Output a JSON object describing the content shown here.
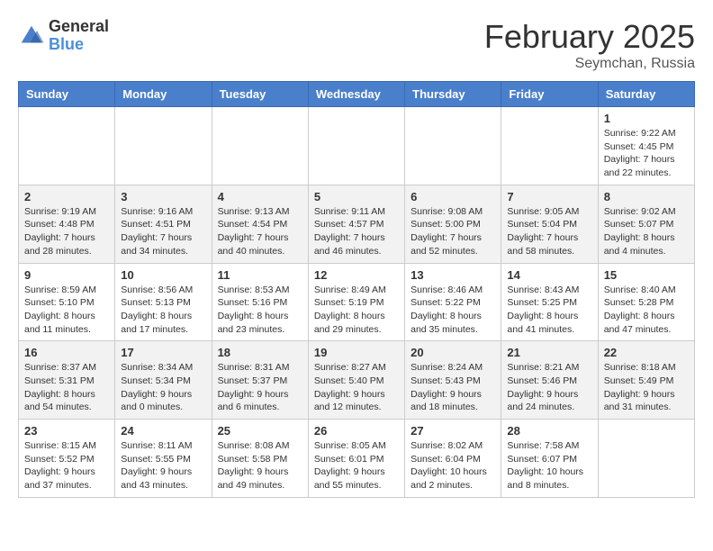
{
  "header": {
    "logo_general": "General",
    "logo_blue": "Blue",
    "month_title": "February 2025",
    "location": "Seymchan, Russia"
  },
  "weekdays": [
    "Sunday",
    "Monday",
    "Tuesday",
    "Wednesday",
    "Thursday",
    "Friday",
    "Saturday"
  ],
  "weeks": [
    [
      {
        "day": "",
        "info": ""
      },
      {
        "day": "",
        "info": ""
      },
      {
        "day": "",
        "info": ""
      },
      {
        "day": "",
        "info": ""
      },
      {
        "day": "",
        "info": ""
      },
      {
        "day": "",
        "info": ""
      },
      {
        "day": "1",
        "info": "Sunrise: 9:22 AM\nSunset: 4:45 PM\nDaylight: 7 hours and 22 minutes."
      }
    ],
    [
      {
        "day": "2",
        "info": "Sunrise: 9:19 AM\nSunset: 4:48 PM\nDaylight: 7 hours and 28 minutes."
      },
      {
        "day": "3",
        "info": "Sunrise: 9:16 AM\nSunset: 4:51 PM\nDaylight: 7 hours and 34 minutes."
      },
      {
        "day": "4",
        "info": "Sunrise: 9:13 AM\nSunset: 4:54 PM\nDaylight: 7 hours and 40 minutes."
      },
      {
        "day": "5",
        "info": "Sunrise: 9:11 AM\nSunset: 4:57 PM\nDaylight: 7 hours and 46 minutes."
      },
      {
        "day": "6",
        "info": "Sunrise: 9:08 AM\nSunset: 5:00 PM\nDaylight: 7 hours and 52 minutes."
      },
      {
        "day": "7",
        "info": "Sunrise: 9:05 AM\nSunset: 5:04 PM\nDaylight: 7 hours and 58 minutes."
      },
      {
        "day": "8",
        "info": "Sunrise: 9:02 AM\nSunset: 5:07 PM\nDaylight: 8 hours and 4 minutes."
      }
    ],
    [
      {
        "day": "9",
        "info": "Sunrise: 8:59 AM\nSunset: 5:10 PM\nDaylight: 8 hours and 11 minutes."
      },
      {
        "day": "10",
        "info": "Sunrise: 8:56 AM\nSunset: 5:13 PM\nDaylight: 8 hours and 17 minutes."
      },
      {
        "day": "11",
        "info": "Sunrise: 8:53 AM\nSunset: 5:16 PM\nDaylight: 8 hours and 23 minutes."
      },
      {
        "day": "12",
        "info": "Sunrise: 8:49 AM\nSunset: 5:19 PM\nDaylight: 8 hours and 29 minutes."
      },
      {
        "day": "13",
        "info": "Sunrise: 8:46 AM\nSunset: 5:22 PM\nDaylight: 8 hours and 35 minutes."
      },
      {
        "day": "14",
        "info": "Sunrise: 8:43 AM\nSunset: 5:25 PM\nDaylight: 8 hours and 41 minutes."
      },
      {
        "day": "15",
        "info": "Sunrise: 8:40 AM\nSunset: 5:28 PM\nDaylight: 8 hours and 47 minutes."
      }
    ],
    [
      {
        "day": "16",
        "info": "Sunrise: 8:37 AM\nSunset: 5:31 PM\nDaylight: 8 hours and 54 minutes."
      },
      {
        "day": "17",
        "info": "Sunrise: 8:34 AM\nSunset: 5:34 PM\nDaylight: 9 hours and 0 minutes."
      },
      {
        "day": "18",
        "info": "Sunrise: 8:31 AM\nSunset: 5:37 PM\nDaylight: 9 hours and 6 minutes."
      },
      {
        "day": "19",
        "info": "Sunrise: 8:27 AM\nSunset: 5:40 PM\nDaylight: 9 hours and 12 minutes."
      },
      {
        "day": "20",
        "info": "Sunrise: 8:24 AM\nSunset: 5:43 PM\nDaylight: 9 hours and 18 minutes."
      },
      {
        "day": "21",
        "info": "Sunrise: 8:21 AM\nSunset: 5:46 PM\nDaylight: 9 hours and 24 minutes."
      },
      {
        "day": "22",
        "info": "Sunrise: 8:18 AM\nSunset: 5:49 PM\nDaylight: 9 hours and 31 minutes."
      }
    ],
    [
      {
        "day": "23",
        "info": "Sunrise: 8:15 AM\nSunset: 5:52 PM\nDaylight: 9 hours and 37 minutes."
      },
      {
        "day": "24",
        "info": "Sunrise: 8:11 AM\nSunset: 5:55 PM\nDaylight: 9 hours and 43 minutes."
      },
      {
        "day": "25",
        "info": "Sunrise: 8:08 AM\nSunset: 5:58 PM\nDaylight: 9 hours and 49 minutes."
      },
      {
        "day": "26",
        "info": "Sunrise: 8:05 AM\nSunset: 6:01 PM\nDaylight: 9 hours and 55 minutes."
      },
      {
        "day": "27",
        "info": "Sunrise: 8:02 AM\nSunset: 6:04 PM\nDaylight: 10 hours and 2 minutes."
      },
      {
        "day": "28",
        "info": "Sunrise: 7:58 AM\nSunset: 6:07 PM\nDaylight: 10 hours and 8 minutes."
      },
      {
        "day": "",
        "info": ""
      }
    ]
  ]
}
